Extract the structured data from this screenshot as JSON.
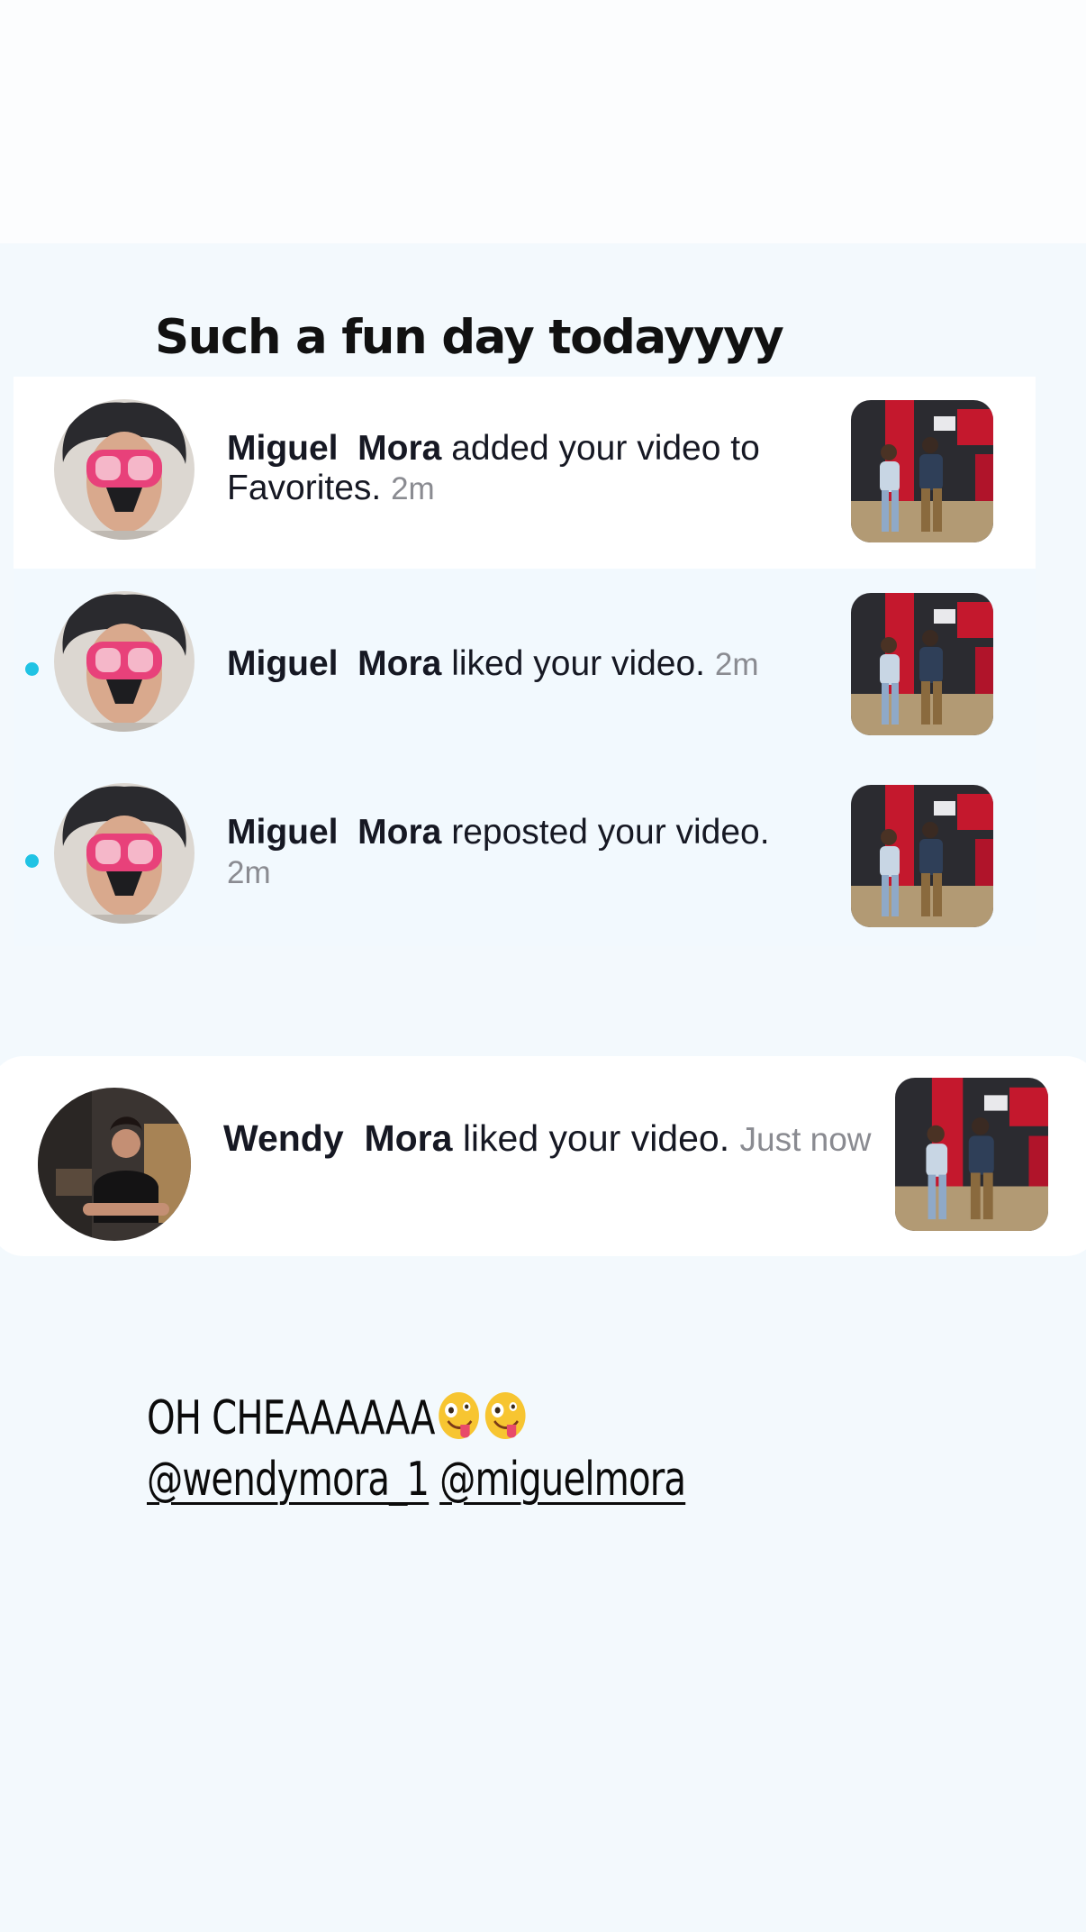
{
  "story": {
    "title": "Such a fun day todayyyy",
    "caption_line1": "OH CHEAAAAAA",
    "caption_emojis": [
      "zany-face-emoji",
      "zany-face-emoji"
    ],
    "mentions": [
      "@wendymora_1",
      "@miguelmora"
    ]
  },
  "notifications": [
    {
      "user_first": "Miguel",
      "user_last": "Mora",
      "action": "added your video to Favorites.",
      "time": "2m",
      "highlighted": true,
      "unread": false
    },
    {
      "user_first": "Miguel",
      "user_last": "Mora",
      "action": "liked your video.",
      "time": "2m",
      "highlighted": false,
      "unread": true
    },
    {
      "user_first": "Miguel",
      "user_last": "Mora",
      "action": "reposted your video.",
      "time": "2m",
      "highlighted": false,
      "unread": true
    }
  ],
  "wendy_notification": {
    "user_first": "Wendy",
    "user_last": "Mora",
    "action": "liked your video.",
    "time": "Just now"
  },
  "colors": {
    "unread_dot": "#20c3e4",
    "goggles": "#e8417a",
    "backdrop_red": "#c4182d"
  }
}
